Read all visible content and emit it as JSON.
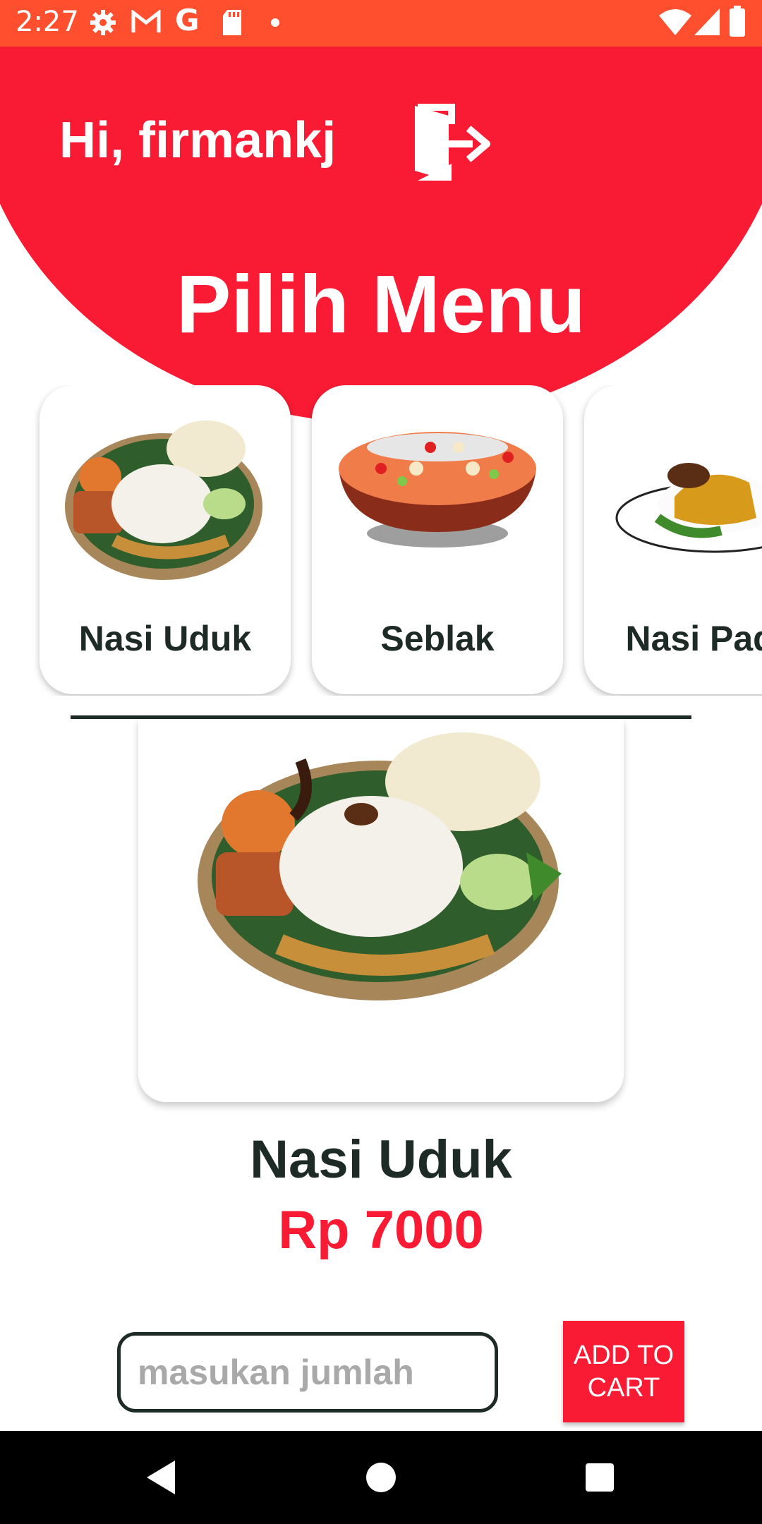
{
  "status_bar": {
    "time": "2:27",
    "icons": [
      "gear-icon",
      "gmail-icon",
      "google-icon",
      "sd-card-icon",
      "dot-icon",
      "wifi-icon",
      "signal-icon",
      "battery-icon"
    ],
    "background": "#FF4F2F"
  },
  "header": {
    "greeting": "Hi, firmankj",
    "logout_icon": "logout-icon",
    "title": "Pilih Menu",
    "background": "#F91B33"
  },
  "categories": [
    {
      "label": "Nasi Uduk",
      "icon": "nasi-uduk-image"
    },
    {
      "label": "Seblak",
      "icon": "seblak-image"
    },
    {
      "label": "Nasi Pada",
      "icon": "nasi-padang-image"
    }
  ],
  "detail": {
    "image": "nasi-uduk-image",
    "name": "Nasi Uduk",
    "price": "Rp 7000",
    "price_color": "#F91B33"
  },
  "order": {
    "quantity_placeholder": "masukan jumlah",
    "quantity_value": "",
    "add_button": "ADD TO CART"
  },
  "navbar": {
    "icons": [
      "back-icon",
      "home-icon",
      "recents-icon"
    ]
  }
}
